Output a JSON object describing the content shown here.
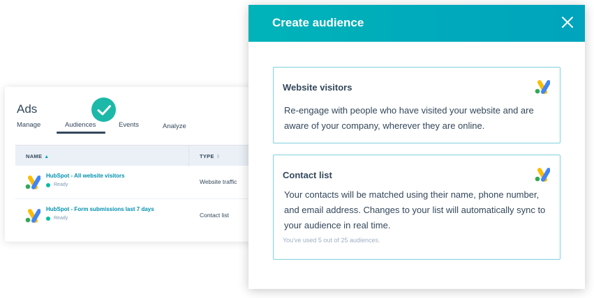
{
  "ads": {
    "title": "Ads",
    "tabs": [
      {
        "label": "Manage"
      },
      {
        "label": "Audiences"
      },
      {
        "label": "Events"
      },
      {
        "label": "Analyze"
      }
    ],
    "table": {
      "columns": [
        {
          "label": "NAME"
        },
        {
          "label": "TYPE"
        }
      ],
      "rows": [
        {
          "name": "HubSpot - All website visitors",
          "status": "Ready",
          "type": "Website traffic"
        },
        {
          "name": "HubSpot - Form submissions last 7 days",
          "status": "Ready",
          "type": "Contact list"
        }
      ]
    }
  },
  "modal": {
    "title": "Create audience",
    "options": [
      {
        "title": "Website visitors",
        "description": "Re-engage with people who have visited your website and are aware of your company, wherever they are online."
      },
      {
        "title": "Contact list",
        "description": "Your contacts will be matched using their name, phone number, and email address. Changes to your list will automatically sync to your audience in real time.",
        "note": "You've used 5 out of 25 audiences."
      }
    ]
  },
  "icons": {
    "check": "check-circle-icon",
    "close": "close-icon",
    "logo": "google-ads-logo",
    "sort": "sort-icon"
  },
  "colors": {
    "teal_header": "#00a4bd",
    "link": "#0091ae",
    "status_ready": "#00bda5",
    "card_border": "#7fd1de",
    "text": "#33475b",
    "check_badge": "#1cb8a8"
  }
}
